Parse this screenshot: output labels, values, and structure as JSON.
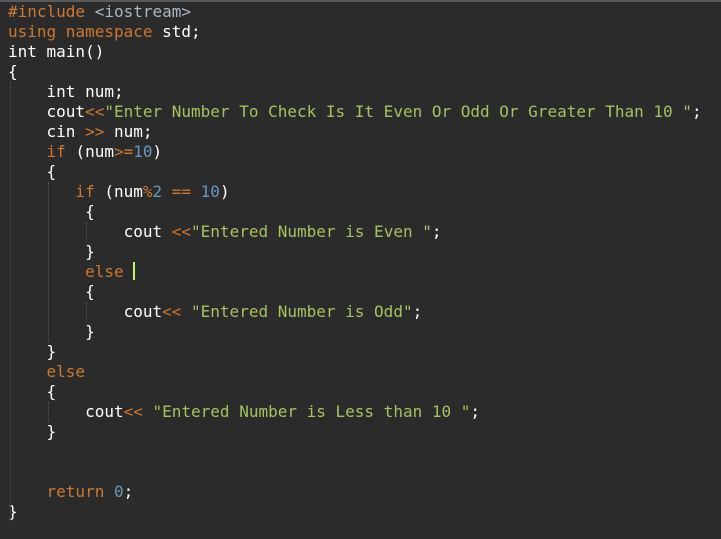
{
  "code_lines": [
    [
      {
        "t": "#include ",
        "c": "pre"
      },
      {
        "t": "<iostream>",
        "c": "hdr"
      }
    ],
    [
      {
        "t": "using ",
        "c": "kw"
      },
      {
        "t": "namespace ",
        "c": "kw"
      },
      {
        "t": "std;",
        "c": "def"
      }
    ],
    [
      {
        "t": "int main()",
        "c": "def"
      }
    ],
    [
      {
        "t": "{",
        "c": "def"
      }
    ],
    [
      {
        "t": "    int num;",
        "c": "def"
      }
    ],
    [
      {
        "t": "    cout",
        "c": "def"
      },
      {
        "t": "<<",
        "c": "op"
      },
      {
        "t": "\"Enter Number To Check Is It Even Or Odd Or Greater Than 10 \"",
        "c": "str"
      },
      {
        "t": ";",
        "c": "def"
      }
    ],
    [
      {
        "t": "    cin ",
        "c": "def"
      },
      {
        "t": ">>",
        "c": "op"
      },
      {
        "t": " num;",
        "c": "def"
      }
    ],
    [
      {
        "t": "    if ",
        "c": "kw"
      },
      {
        "t": "(num",
        "c": "def"
      },
      {
        "t": ">=",
        "c": "op"
      },
      {
        "t": "10",
        "c": "num"
      },
      {
        "t": ")",
        "c": "def"
      }
    ],
    [
      {
        "t": "    {",
        "c": "def"
      }
    ],
    [
      {
        "t": "       if ",
        "c": "kw"
      },
      {
        "t": "(num",
        "c": "def"
      },
      {
        "t": "%",
        "c": "op"
      },
      {
        "t": "2",
        "c": "num"
      },
      {
        "t": " == ",
        "c": "op"
      },
      {
        "t": "10",
        "c": "num"
      },
      {
        "t": ")",
        "c": "def"
      }
    ],
    [
      {
        "t": "        {",
        "c": "def"
      }
    ],
    [
      {
        "t": "            cout ",
        "c": "def"
      },
      {
        "t": "<<",
        "c": "op"
      },
      {
        "t": "\"Entered Number is Even \"",
        "c": "str"
      },
      {
        "t": ";",
        "c": "def"
      }
    ],
    [
      {
        "t": "        }",
        "c": "def"
      }
    ],
    [
      {
        "t": "        else ",
        "c": "kw"
      }
    ],
    [
      {
        "t": "        {",
        "c": "def"
      }
    ],
    [
      {
        "t": "            cout",
        "c": "def"
      },
      {
        "t": "<<",
        "c": "op"
      },
      {
        "t": " \"Entered Number is Odd\"",
        "c": "str"
      },
      {
        "t": ";",
        "c": "def"
      }
    ],
    [
      {
        "t": "        }",
        "c": "def"
      }
    ],
    [
      {
        "t": "    }",
        "c": "def"
      }
    ],
    [
      {
        "t": "    else",
        "c": "kw"
      }
    ],
    [
      {
        "t": "    {",
        "c": "def"
      }
    ],
    [
      {
        "t": "        cout",
        "c": "def"
      },
      {
        "t": "<<",
        "c": "op"
      },
      {
        "t": " \"Entered Number is Less than 10 \"",
        "c": "str"
      },
      {
        "t": ";",
        "c": "def"
      }
    ],
    [
      {
        "t": "    }",
        "c": "def"
      }
    ],
    [],
    [],
    [
      {
        "t": "    return ",
        "c": "kw"
      },
      {
        "t": "0",
        "c": "num"
      },
      {
        "t": ";",
        "c": "def"
      }
    ],
    [
      {
        "t": "}",
        "c": "def"
      }
    ]
  ],
  "current_line_index": 13,
  "caret_after_token_index": 0,
  "colors": {
    "background": "#2b2b2b",
    "current_line": "#383838",
    "keyword": "#cc7832",
    "string": "#a5c261",
    "number": "#6897bb",
    "default": "#ffffff",
    "caret": "#c8f26a"
  }
}
